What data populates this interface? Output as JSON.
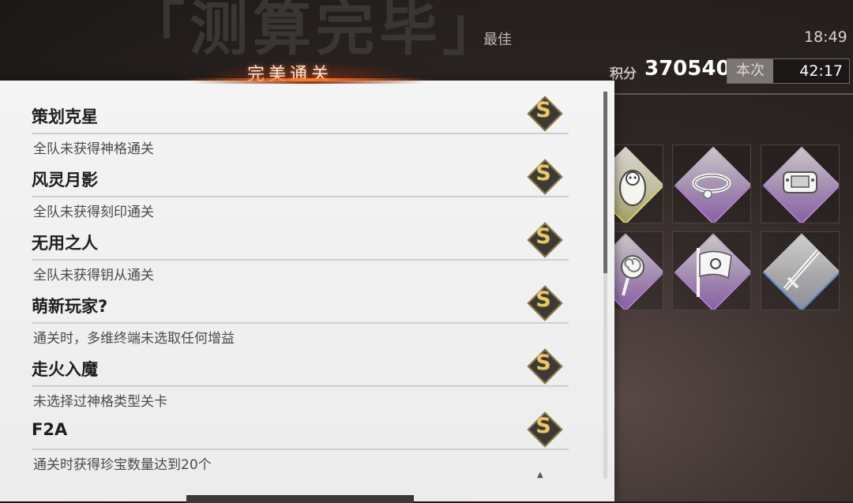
{
  "background": {
    "title": "「测算完毕」"
  },
  "stats": {
    "best_label": "最佳",
    "best_time": "18:49",
    "score_label": "积分",
    "score_value": "370540",
    "current_label": "本次",
    "current_time": "42:17"
  },
  "panel": {
    "header": "完美通关",
    "items": [
      {
        "title": "策划克星",
        "desc": "全队未获得神格通关",
        "badge": "S"
      },
      {
        "title": "风灵月影",
        "desc": "全队未获得刻印通关",
        "badge": "S"
      },
      {
        "title": "无用之人",
        "desc": "全队未获得钥从通关",
        "badge": "S"
      },
      {
        "title": "萌新玩家?",
        "desc": "通关时，多维终端未选取任何增益",
        "badge": "S"
      },
      {
        "title": "走火入魔",
        "desc": "未选择过神格类型关卡",
        "badge": "S"
      },
      {
        "title": "F2A",
        "desc": "通关时获得珍宝数量达到20个",
        "badge": "S"
      }
    ]
  },
  "relics": [
    {
      "icon": "matryoshka-doll-icon",
      "rarity": "gold"
    },
    {
      "icon": "collar-icon",
      "rarity": "purple"
    },
    {
      "icon": "handheld-console-icon",
      "rarity": "purple"
    },
    {
      "icon": "lollipop-icon",
      "rarity": "purple"
    },
    {
      "icon": "pirate-flag-icon",
      "rarity": "purple"
    },
    {
      "icon": "sword-icon",
      "rarity": "blue"
    }
  ],
  "colors": {
    "accent_orange": "#ff7a2a",
    "badge_gold": "#e9c66a"
  }
}
